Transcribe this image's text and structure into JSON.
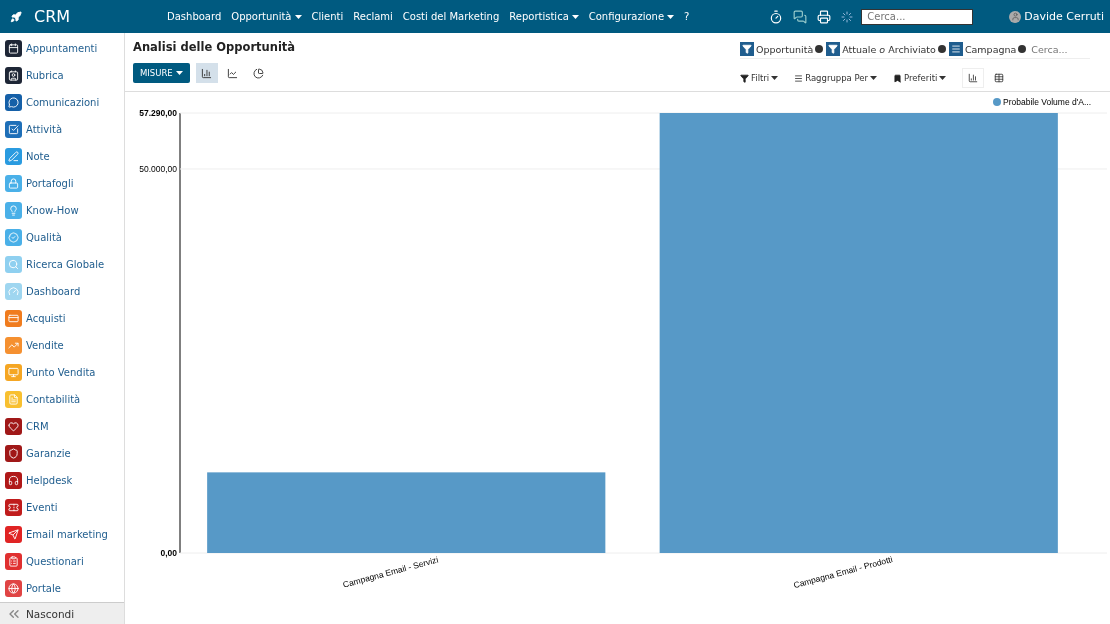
{
  "app_title": "CRM",
  "menu": [
    {
      "label": "Dashboard",
      "dropdown": false
    },
    {
      "label": "Opportunità",
      "dropdown": true
    },
    {
      "label": "Clienti",
      "dropdown": false
    },
    {
      "label": "Reclami",
      "dropdown": false
    },
    {
      "label": "Costi del Marketing",
      "dropdown": false
    },
    {
      "label": "Reportistica",
      "dropdown": true
    },
    {
      "label": "Configurazione",
      "dropdown": true
    },
    {
      "label": "?",
      "dropdown": false
    }
  ],
  "top_search": {
    "placeholder": "Cerca..."
  },
  "user": {
    "name": "Davide Cerruti"
  },
  "sidebar": {
    "items": [
      {
        "label": "Appuntamenti",
        "color": "#1e2636"
      },
      {
        "label": "Rubrica",
        "color": "#1e2636"
      },
      {
        "label": "Comunicazioni",
        "color": "#1560a8"
      },
      {
        "label": "Attività",
        "color": "#1e6fb8"
      },
      {
        "label": "Note",
        "color": "#2a9be0"
      },
      {
        "label": "Portafogli",
        "color": "#4ab0e8"
      },
      {
        "label": "Know-How",
        "color": "#4ab0e8"
      },
      {
        "label": "Qualità",
        "color": "#4ab0e8"
      },
      {
        "label": "Ricerca Globale",
        "color": "#8fd0f0"
      },
      {
        "label": "Dashboard",
        "color": "#9fd6f0"
      },
      {
        "label": "Acquisti",
        "color": "#f07c1e"
      },
      {
        "label": "Vendite",
        "color": "#f59030"
      },
      {
        "label": "Punto Vendita",
        "color": "#f5a623"
      },
      {
        "label": "Contabilità",
        "color": "#f8c030"
      },
      {
        "label": "CRM",
        "color": "#a01818"
      },
      {
        "label": "Garanzie",
        "color": "#a01818"
      },
      {
        "label": "Helpdesk",
        "color": "#b01818"
      },
      {
        "label": "Eventi",
        "color": "#c01c1c"
      },
      {
        "label": "Email marketing",
        "color": "#e02424"
      },
      {
        "label": "Questionari",
        "color": "#e03030"
      },
      {
        "label": "Portale",
        "color": "#e04444"
      }
    ],
    "hide_label": "Nascondi"
  },
  "page_title": "Analisi delle Opportunità",
  "measures_button": "MISURE",
  "chart_modes": [
    {
      "kind": "bar",
      "selected": true
    },
    {
      "kind": "line",
      "selected": false
    },
    {
      "kind": "pie",
      "selected": false
    }
  ],
  "facets": [
    {
      "kind": "filter",
      "label": "Opportunità"
    },
    {
      "kind": "filter",
      "label": "Attuale *o* Archiviato"
    },
    {
      "kind": "group",
      "label": "Campagna"
    }
  ],
  "search": {
    "placeholder": "Cerca..."
  },
  "search_options": [
    {
      "kind": "filter",
      "label": "Filtri"
    },
    {
      "kind": "group",
      "label": "Raggruppa Per"
    },
    {
      "kind": "favorite",
      "label": "Preferiti"
    }
  ],
  "views": [
    {
      "kind": "graph",
      "selected": true
    },
    {
      "kind": "pivot",
      "selected": false
    }
  ],
  "chart_data": {
    "type": "bar",
    "categories": [
      "Campagna Email - Servizi",
      "Campagna Email - Prodotti"
    ],
    "series": [
      {
        "name": "Probabile Volume d'A...",
        "color": "#5799c7",
        "values": [
          10500,
          57290
        ]
      }
    ],
    "ylim": [
      0,
      57290
    ],
    "yticks": [
      {
        "value": 0,
        "label": "0,00"
      },
      {
        "value": 50000,
        "label": "50.000,00"
      },
      {
        "value": 57290,
        "label": "57.290,00"
      }
    ]
  }
}
